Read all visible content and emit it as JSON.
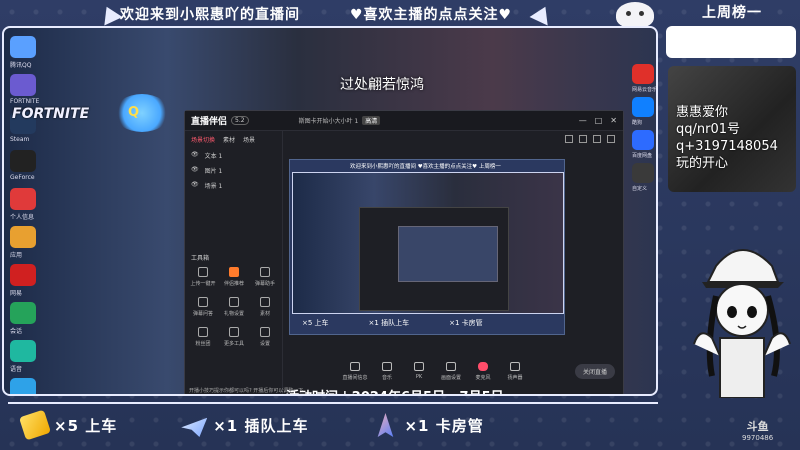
{
  "overlay_top": {
    "welcome_text": "欢迎来到小熙惠吖的直播间",
    "follow_text": "♥喜欢主播的点点关注♥",
    "rank_title": "上周榜一"
  },
  "stream_overlay": {
    "title_text": "过处翩若惊鸿",
    "event_text": "活动时间 | 2024年6月5日 - 7月5日",
    "fortnite_text": "FORTNITE"
  },
  "desktop_icons": [
    {
      "label": "腾讯QQ",
      "color": "#5aa0ff"
    },
    {
      "label": "FORTNITE",
      "color": "#6b5bd0"
    },
    {
      "label": "Steam",
      "color": "#233a5e"
    },
    {
      "label": "GeForce",
      "color": "#222222"
    },
    {
      "label": "个人信息",
      "color": "#e03a3a"
    },
    {
      "label": "应用",
      "color": "#e8a030"
    },
    {
      "label": "网易",
      "color": "#d02020"
    },
    {
      "label": "会话",
      "color": "#25a35a"
    },
    {
      "label": "语音",
      "color": "#1fb8a0"
    },
    {
      "label": "浏览器",
      "color": "#2ea2e8"
    }
  ],
  "right_apps": [
    {
      "label": "网易云音乐",
      "color": "#e0302a"
    },
    {
      "label": "酷狗",
      "color": "#1080ff"
    },
    {
      "label": "百度网盘",
      "color": "#2d6bff"
    },
    {
      "label": "自定义",
      "color": "#3a3a3a"
    }
  ],
  "software": {
    "brand": "直播伴侣",
    "brand_tag": "5.2",
    "session_label": "斯图卡开始小大小叶 1",
    "session_tag": "高清",
    "scene_tabs": [
      "场景切换",
      "素材",
      "场景"
    ],
    "scenes": [
      "文本 1",
      "图片 1",
      "场景 1"
    ],
    "tools_label": "工具箱",
    "tools": [
      {
        "label": "上传一键开",
        "hot": false
      },
      {
        "label": "伴侣推荐",
        "hot": true
      },
      {
        "label": "弹幕助手",
        "hot": false
      },
      {
        "label": "弹幕问答",
        "hot": false
      },
      {
        "label": "礼物设置",
        "hot": false
      },
      {
        "label": "素材",
        "hot": false
      },
      {
        "label": "粉丝团",
        "hot": false
      },
      {
        "label": "更多工具",
        "hot": false
      },
      {
        "label": "设置",
        "hot": false
      }
    ],
    "footer_text": "开播小技巧提示你都可以吗? 开播后你可以调整一下",
    "bottom_tools": [
      "直播间信息",
      "音乐",
      "PK",
      "画面设置",
      "麦克风",
      "扬声器"
    ],
    "go_live": "关闭直播",
    "controls": [
      "—",
      "□",
      "✕"
    ]
  },
  "preview": {
    "nested_top": "欢迎来到小熙惠吖的直播间   ♥喜欢主播的点点关注♥   上周榜一",
    "nested_gifts": [
      "×5 上车",
      "×1 插队上车",
      "×1 卡房管"
    ]
  },
  "webcam": {
    "lines": [
      "惠惠爱你",
      "qq/nr01号",
      "q+3197148054",
      "玩的开心"
    ]
  },
  "watermark": {
    "logo": "斗鱼",
    "room": "9970486"
  },
  "gifts": [
    {
      "label": "×5 上车",
      "kind": "ticket"
    },
    {
      "label": "×1 插队上车",
      "kind": "plane"
    },
    {
      "label": "×1 卡房管",
      "kind": "rocket"
    }
  ]
}
